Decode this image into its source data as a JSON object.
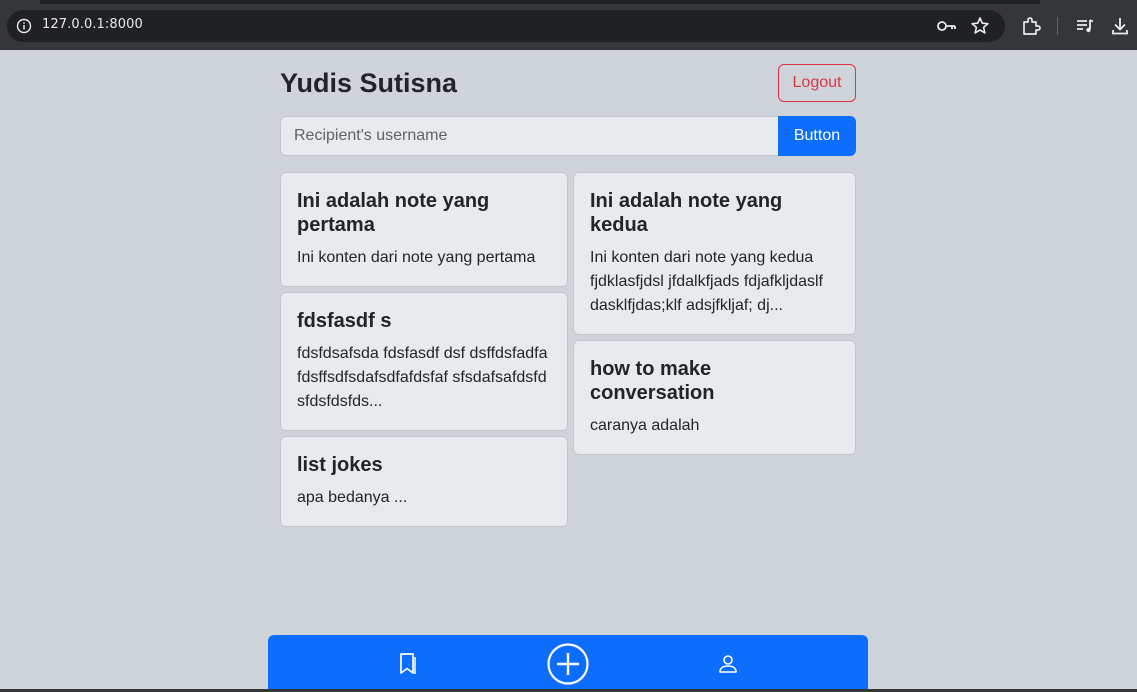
{
  "browser": {
    "url": "127.0.0.1:8000"
  },
  "header": {
    "title": "Yudis Sutisna",
    "logout_label": "Logout"
  },
  "search": {
    "placeholder": "Recipient's username",
    "value": "",
    "button_label": "Button"
  },
  "notes": {
    "left": [
      {
        "title": "Ini adalah note yang pertama",
        "content": "Ini konten dari note yang pertama"
      },
      {
        "title": "fdsfasdf s",
        "content": "fdsfdsafsda fdsfasdf dsf dsffdsfadfafdsffsdfsdafsdfafdsfaf sfsdafsafdsfdsfdsfdsfds..."
      },
      {
        "title": "list jokes",
        "content": "apa bedanya ..."
      }
    ],
    "right": [
      {
        "title": "Ini adalah note yang kedua",
        "content": "Ini konten dari note yang kedua fjdklasfjdsl jfdalkfjads fdjafkljdaslf dasklfjdas;klf adsjfkljaf; dj..."
      },
      {
        "title": "how to make conversation",
        "content": "caranya adalah"
      }
    ]
  },
  "bottom_nav": {
    "items": [
      {
        "icon": "bookmark-icon"
      },
      {
        "icon": "plus-circle-icon"
      },
      {
        "icon": "person-icon"
      }
    ]
  },
  "colors": {
    "primary": "#0d6efd",
    "danger": "#dc3545",
    "background": "#cfd4db",
    "card": "#e8ebee"
  }
}
